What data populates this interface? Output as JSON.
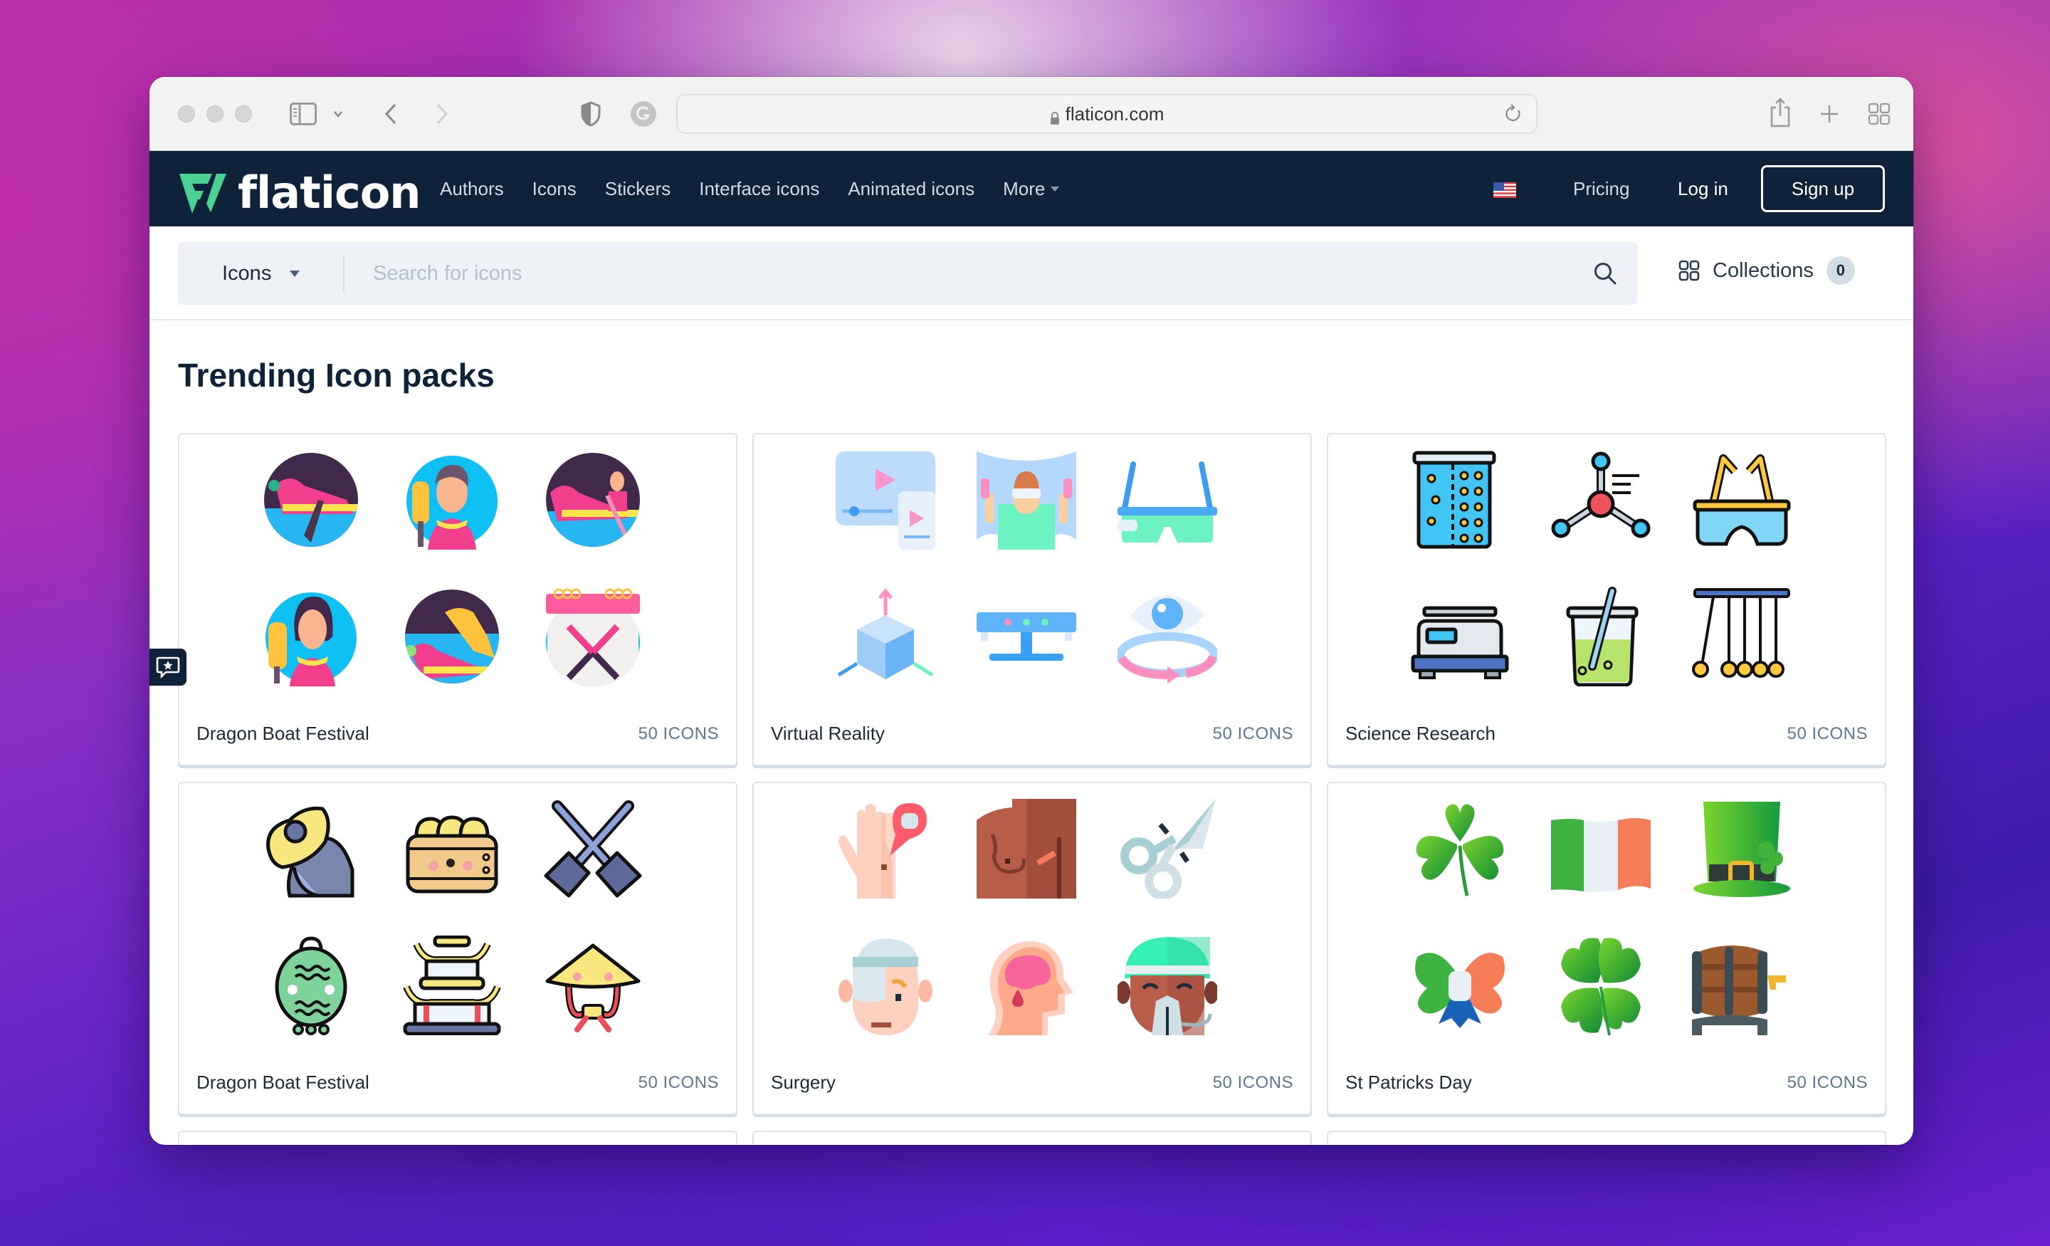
{
  "browser": {
    "url": "flaticon.com",
    "toolbar_icons": [
      "sidebar-icon",
      "chevron-down-icon",
      "back-icon",
      "forward-icon",
      "shield-icon",
      "grammarly-icon",
      "share-icon",
      "new-tab-icon",
      "tab-overview-icon"
    ]
  },
  "navbar": {
    "brand": "flaticon",
    "brand_color": "#4ad295",
    "links": [
      {
        "label": "Authors"
      },
      {
        "label": "Icons"
      },
      {
        "label": "Stickers"
      },
      {
        "label": "Interface icons"
      },
      {
        "label": "Animated icons"
      },
      {
        "label": "More"
      }
    ],
    "language_flag": "us-flag-icon",
    "pricing": "Pricing",
    "login": "Log in",
    "signup": "Sign up"
  },
  "search": {
    "type_selected": "Icons",
    "placeholder": "Search for icons",
    "value": "",
    "collections_label": "Collections",
    "collections_count": "0"
  },
  "main": {
    "title": "Trending Icon packs",
    "packs": [
      {
        "title": "Dragon Boat Festival",
        "count": "50 ICONS",
        "style": "round-flat",
        "icons": [
          "dragon-boat-rower",
          "man-with-paddle",
          "woman-rowing-boat",
          "woman-with-paddle",
          "two-dragon-boats",
          "calendar-crossed-paddles"
        ]
      },
      {
        "title": "Virtual Reality",
        "count": "50 ICONS",
        "style": "flat-blue",
        "icons": [
          "video-player-mobile",
          "vr-workout",
          "smart-glasses",
          "3d-cube-axes",
          "motion-sensor",
          "360-eye-view"
        ]
      },
      {
        "title": "Science Research",
        "count": "50 ICONS",
        "style": "lineal-color",
        "icons": [
          "diffusion-container",
          "molecule",
          "safety-goggles",
          "digital-scale",
          "beaker-stirring",
          "newtons-cradle"
        ]
      },
      {
        "title": "Dragon Boat Festival",
        "count": "50 ICONS",
        "style": "kawaii-lineal",
        "icons": [
          "dragon-head",
          "dumpling-steamer",
          "crossed-paddles",
          "green-lantern",
          "pagoda",
          "conical-hat"
        ]
      },
      {
        "title": "Surgery",
        "count": "50 ICONS",
        "style": "flat-split",
        "icons": [
          "hand-mole",
          "breast-surgery",
          "surgical-scissors",
          "bandaged-head",
          "brain-bleed",
          "surgeon-oxygen-mask"
        ]
      },
      {
        "title": "St Patricks Day",
        "count": "50 ICONS",
        "style": "gradient",
        "icons": [
          "shamrock",
          "irish-flag",
          "leprechaun-hat",
          "tricolor-bow",
          "four-leaf-clover",
          "beer-barrel"
        ]
      }
    ]
  },
  "feedback": {
    "icon": "feedback-star-icon"
  }
}
